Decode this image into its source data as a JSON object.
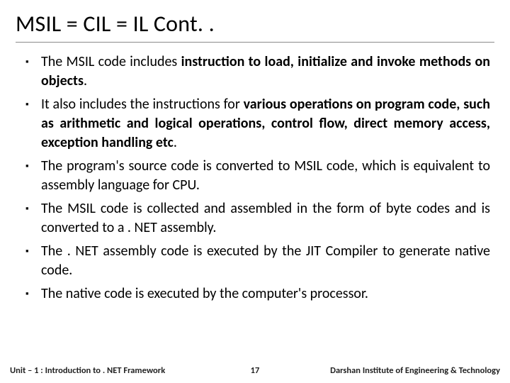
{
  "title": "MSIL = CIL = IL Cont. .",
  "bullets": [
    {
      "pre": "The MSIL code includes ",
      "bold": "instruction to load, initialize and invoke methods on objects",
      "post": "."
    },
    {
      "pre": "It also includes the instructions for ",
      "bold": "various operations on program code, such as arithmetic and logical operations, control flow, direct memory access, exception handling etc",
      "post": "."
    },
    {
      "pre": "The program's source code is converted to MSIL code, which is equivalent to assembly language for CPU.",
      "bold": "",
      "post": ""
    },
    {
      "pre": "The MSIL code is collected and assembled in the form of byte codes and is converted to a . NET assembly.",
      "bold": "",
      "post": ""
    },
    {
      "pre": "The . NET assembly code is executed by the JIT Compiler to generate native code.",
      "bold": "",
      "post": ""
    },
    {
      "pre": "The native code is executed by the computer's processor.",
      "bold": "",
      "post": ""
    }
  ],
  "footer": {
    "left": "Unit – 1 : Introduction to . NET Framework",
    "center": "17",
    "right": "Darshan Institute of Engineering & Technology"
  }
}
